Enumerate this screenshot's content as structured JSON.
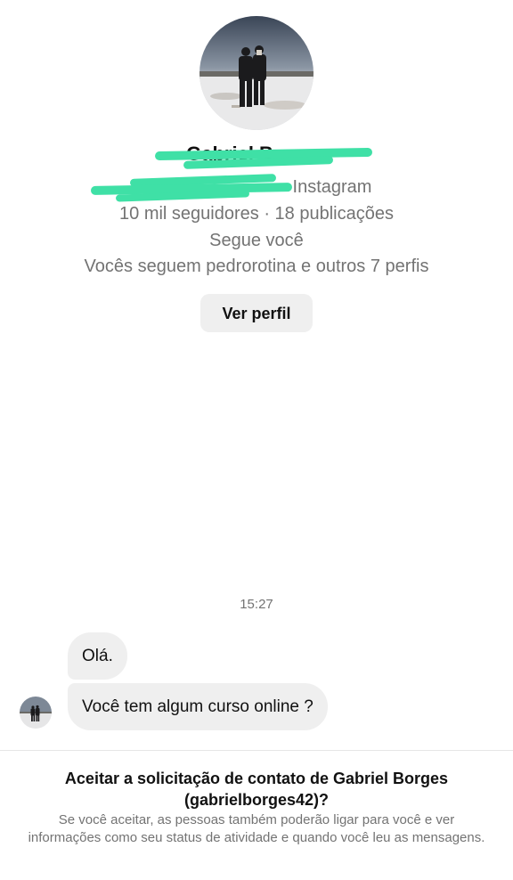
{
  "profile": {
    "avatar": "profile-photo-two-people-snow",
    "name": "Gabriel Borges",
    "handle_suffix": "Instagram",
    "stats": "10 mil seguidores · 18 publicações",
    "follows_you": "Segue você",
    "mutual": "Vocês seguem pedrorotina e outros 7 perfis",
    "view_profile_label": "Ver perfil"
  },
  "chat": {
    "timestamp": "15:27",
    "messages": [
      {
        "text": "Olá."
      },
      {
        "text": "Você tem algum curso online ?"
      }
    ]
  },
  "request": {
    "title": "Aceitar a solicitação de contato de Gabriel Borges (gabrielborges42)?",
    "description": "Se você aceitar, as pessoas também poderão ligar para você e ver informações como seu status de atividade e quando você leu as mensagens."
  },
  "colors": {
    "redaction": "#3fe0a6",
    "secondary_text": "#737373",
    "bubble_bg": "#efefef"
  }
}
